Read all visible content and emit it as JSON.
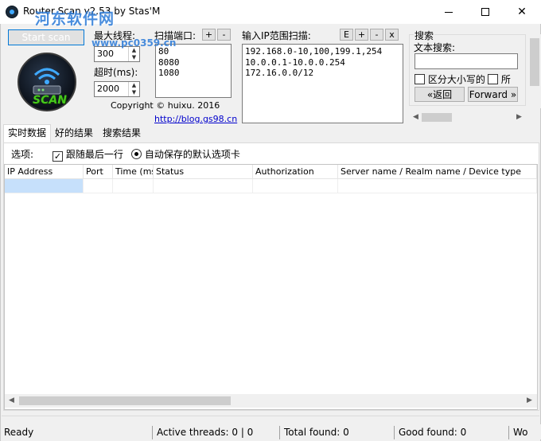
{
  "window": {
    "title": "Router Scan v2.53 by Stas'M",
    "min_label": "—",
    "close_label": "✕"
  },
  "watermark": {
    "text": "河东软件网",
    "url": "www.pc0359.cn"
  },
  "controls": {
    "start_scan": "Start scan",
    "max_threads_label": "最大线程:",
    "max_threads_value": "300",
    "timeout_label": "超时(ms):",
    "timeout_value": "2000",
    "logo_text": "SCAN",
    "copyright": "Copyright © huixu. 2016",
    "link": "http://blog.gs98.cn"
  },
  "ports": {
    "label": "扫描端口:",
    "add": "+",
    "remove": "-",
    "items": [
      "80",
      "8080",
      "1080"
    ]
  },
  "ip_ranges": {
    "label": "输入IP范围扫描:",
    "btn_e": "E",
    "btn_add": "+",
    "btn_remove": "-",
    "btn_x": "x",
    "items": [
      "192.168.0-10,100,199.1,254",
      "10.0.0.1-10.0.0.254",
      "172.16.0.0/12"
    ]
  },
  "search": {
    "group_label": "搜索",
    "text_label": "文本搜索:",
    "value": "",
    "case_label": "区分大小写的",
    "all_label": "所",
    "back": "«返回",
    "forward": "Forward »"
  },
  "tabs": [
    "实时数据",
    "好的结果",
    "搜索结果"
  ],
  "options": {
    "label": "选项:",
    "follow_last": "跟随最后一行",
    "auto_save": "自动保存的默认选项卡"
  },
  "columns": [
    "IP Address",
    "Port",
    "Time (ms)",
    "Status",
    "Authorization",
    "Server name / Realm name / Device type"
  ],
  "status": {
    "ready": "Ready",
    "threads": "Active threads: 0 | 0",
    "total": "Total found: 0",
    "good": "Good found: 0",
    "extra": "Wo"
  }
}
